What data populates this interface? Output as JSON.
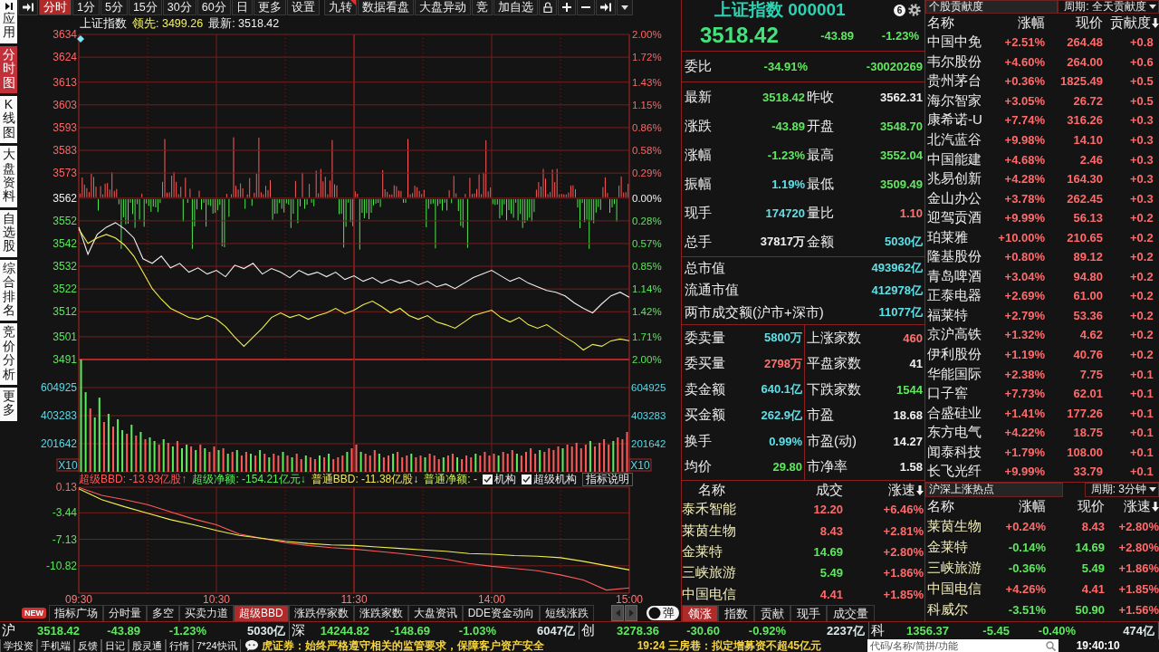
{
  "sidebar": {
    "tabs": [
      {
        "label": "应用",
        "selected": false
      },
      {
        "label": "分时图",
        "selected": true
      },
      {
        "label": "K线图",
        "selected": false
      },
      {
        "label": "大盘资料",
        "selected": false
      },
      {
        "label": "自选股",
        "selected": false
      },
      {
        "label": "综合排名",
        "selected": false
      },
      {
        "label": "竞价分析",
        "selected": false
      },
      {
        "label": "更多",
        "selected": false
      }
    ]
  },
  "toolbar": {
    "period_tabs": [
      {
        "label": "分时",
        "selected": true
      },
      {
        "label": "1分",
        "selected": false
      },
      {
        "label": "5分",
        "selected": false
      },
      {
        "label": "15分",
        "selected": false
      },
      {
        "label": "30分",
        "selected": false
      },
      {
        "label": "60分",
        "selected": false
      },
      {
        "label": "日",
        "selected": false
      },
      {
        "label": "更多",
        "selected": false
      },
      {
        "label": "设置",
        "selected": false
      }
    ],
    "actions": [
      {
        "label": "九转",
        "marked": true
      },
      {
        "label": "数据看盘",
        "marked": false
      },
      {
        "label": "大盘异动",
        "marked": false
      },
      {
        "label": "竞",
        "marked": false
      },
      {
        "label": "加自选",
        "marked": false
      }
    ]
  },
  "quote_line": [
    {
      "text": "上证指数",
      "color": "#f0f0f0"
    },
    {
      "text": "领先: 3499.26",
      "color": "#f0f060"
    },
    {
      "text": "最新: 3518.42",
      "color": "#f0f0f0"
    }
  ],
  "price_chart": {
    "chart_data": {
      "type": "line",
      "grid": true,
      "ylim": [
        3491,
        3634
      ],
      "yticks": [
        3634,
        3624,
        3613,
        3603,
        3593,
        3583,
        3573,
        3562,
        3552,
        3542,
        3532,
        3522,
        3512,
        3501,
        3491
      ],
      "series": [
        {
          "color": "#f0f0f0",
          "values": [
            3549.2,
            3537.3,
            3546.0,
            3549.2,
            3551.2,
            3548.4,
            3544.5,
            3535.3,
            3533.3,
            3536.5,
            3531.3,
            3533.3,
            3529.4,
            3531.3,
            3528.6,
            3530.2,
            3527.4,
            3532.5,
            3531.0,
            3533.3,
            3528.6,
            3531.0,
            3529.4,
            3527.0,
            3530.2,
            3528.2,
            3529.4,
            3527.4,
            3529.4,
            3526.2,
            3527.8,
            3525.4,
            3527.0,
            3524.6,
            3526.2,
            3524.6,
            3525.8,
            3523.8,
            3525.4,
            3523.0,
            3524.2,
            3522.2,
            3524.6,
            3527.0,
            3528.6,
            3530.2,
            3527.8,
            3525.4,
            3527.0,
            3524.6,
            3523.0,
            3521.4,
            3520.6,
            3519.0,
            3515.9,
            3513.5,
            3511.5,
            3515.5,
            3519.0,
            3520.6,
            3518.4
          ]
        },
        {
          "color": "#f0f050",
          "values": [
            3548.4,
            3542.1,
            3544.5,
            3546.0,
            3544.5,
            3541.3,
            3536.5,
            3529.4,
            3522.2,
            3517.5,
            3513.5,
            3511.5,
            3509.5,
            3508.7,
            3510.3,
            3508.7,
            3505.5,
            3500.8,
            3496.8,
            3500.8,
            3504.8,
            3509.5,
            3511.5,
            3509.5,
            3510.7,
            3508.7,
            3510.3,
            3511.5,
            3513.5,
            3511.1,
            3512.7,
            3515.1,
            3516.7,
            3514.3,
            3511.5,
            3513.5,
            3510.3,
            3508.7,
            3510.3,
            3507.5,
            3506.3,
            3504.8,
            3507.5,
            3510.3,
            3511.5,
            3512.7,
            3509.5,
            3507.5,
            3509.5,
            3506.3,
            3504.8,
            3506.3,
            3503.6,
            3500.8,
            3498.4,
            3495.2,
            3497.6,
            3496.8,
            3499.2,
            3500.0,
            3499.3
          ]
        }
      ]
    },
    "percent_labels": [
      "2.00%",
      "1.72%",
      "1.43%",
      "1.15%",
      "0.86%",
      "0.58%",
      "0.29%",
      "0.00%",
      "0.28%",
      "0.57%",
      "0.85%",
      "1.14%",
      "1.42%",
      "1.71%",
      "2.00%"
    ]
  },
  "volume_chart": {
    "chart_data": {
      "type": "bar",
      "grid": true,
      "ylim": [
        0,
        806566
      ],
      "yticks": [
        604925,
        403283,
        201642
      ],
      "series": [
        {
          "color": "#ff5a5a",
          "values": [
            0,
            0,
            455000,
            0,
            0,
            358000,
            0,
            325000,
            0,
            0,
            273000,
            0,
            260000,
            0,
            234000,
            0,
            0,
            195000,
            0,
            208000,
            0,
            221000,
            0,
            0,
            182000,
            0,
            195000,
            0,
            143000,
            182000,
            0,
            169000,
            0,
            143000,
            0,
            117000,
            143000,
            0,
            117000,
            0,
            130000,
            0,
            130000,
            117000,
            0,
            117000,
            0,
            130000,
            91000,
            0,
            104000,
            91000,
            0,
            104000,
            0,
            91000,
            104000,
            117000,
            0,
            169000,
            195000,
            0,
            130000,
            117000,
            156000,
            0,
            104000,
            117000,
            0,
            143000,
            104000,
            117000,
            0,
            104000,
            117000,
            0,
            130000,
            117000,
            91000,
            0,
            117000,
            130000,
            0,
            91000,
            117000,
            104000,
            0,
            117000,
            143000,
            117000,
            130000,
            0,
            143000,
            130000,
            156000,
            0,
            117000,
            143000,
            169000,
            130000,
            0,
            143000,
            169000,
            156000,
            182000,
            0,
            195000,
            182000,
            208000,
            169000,
            195000,
            0,
            182000,
            208000,
            234000,
            195000,
            0,
            247000,
            234000,
            286000
          ]
        },
        {
          "color": "#5aef5a",
          "values": [
            806000,
            572000,
            0,
            390000,
            533000,
            0,
            416000,
            0,
            377000,
            299000,
            0,
            338000,
            0,
            286000,
            0,
            247000,
            221000,
            0,
            234000,
            0,
            182000,
            0,
            169000,
            195000,
            0,
            156000,
            0,
            169000,
            0,
            0,
            156000,
            0,
            130000,
            0,
            156000,
            0,
            0,
            130000,
            0,
            156000,
            0,
            104000,
            0,
            0,
            143000,
            0,
            104000,
            0,
            0,
            117000,
            0,
            0,
            117000,
            0,
            130000,
            0,
            0,
            0,
            143000,
            0,
            0,
            143000,
            0,
            0,
            0,
            130000,
            0,
            0,
            130000,
            0,
            0,
            0,
            130000,
            0,
            0,
            104000,
            0,
            0,
            0,
            104000,
            0,
            0,
            104000,
            0,
            0,
            0,
            130000,
            0,
            0,
            0,
            0,
            117000,
            0,
            0,
            0,
            130000,
            0,
            0,
            0,
            0,
            156000,
            0,
            0,
            0,
            0,
            169000,
            0,
            0,
            0,
            0,
            0,
            221000,
            0,
            0,
            0,
            0,
            221000,
            0,
            0,
            0
          ]
        }
      ]
    },
    "right_labels": [
      "604925",
      "403283",
      "201642"
    ],
    "unit_label_left": "X10",
    "unit_label_right": "X10"
  },
  "bbd_header": {
    "readouts": [
      {
        "text": "超级BBD: -13.93亿股↑",
        "color": "#ff5a5a"
      },
      {
        "text": "超级净额: -154.21亿元↓",
        "color": "#5aef5a"
      },
      {
        "text": "普通BBD: -11.38亿股↓",
        "color": "#f0e860"
      },
      {
        "text": "普通净额: -",
        "color": "#c8f060"
      }
    ],
    "options": [
      {
        "label": "机构",
        "checked": true
      },
      {
        "label": "超级机构",
        "checked": true
      }
    ],
    "help_button": "指标说明"
  },
  "bbd_chart": {
    "chart_data": {
      "type": "line",
      "grid": true,
      "categories": [
        "09:30",
        null,
        null,
        null,
        null,
        null,
        "10:30",
        null,
        null,
        null,
        null,
        null,
        "11:30",
        null,
        null,
        null,
        null,
        null,
        "14:00",
        null,
        null,
        null,
        null,
        null,
        "15:00"
      ],
      "ylim": [
        -14.63,
        0.13
      ],
      "yticks": [
        0.13,
        -3.44,
        -7.13,
        -10.82
      ],
      "series": [
        {
          "color": "#ff5a5a",
          "values": [
            0.1,
            -1.0,
            -1.6,
            -2.3,
            -3.3,
            -4.3,
            -5.1,
            -6.4,
            -7.0,
            -7.6,
            -8.0,
            -8.3,
            -8.5,
            -8.8,
            -9.1,
            -9.5,
            -9.9,
            -10.5,
            -10.9,
            -11.2,
            -11.5,
            -12.1,
            -12.8,
            -14.2,
            -13.9
          ]
        },
        {
          "color": "#f0f050",
          "values": [
            -0.1,
            -1.6,
            -2.6,
            -3.5,
            -4.4,
            -5.1,
            -5.9,
            -6.6,
            -7.0,
            -7.4,
            -7.7,
            -7.9,
            -8.0,
            -8.2,
            -8.4,
            -8.6,
            -8.8,
            -9.1,
            -9.2,
            -9.4,
            -9.5,
            -9.7,
            -10.2,
            -10.8,
            -11.4
          ]
        }
      ]
    }
  },
  "indicator_tabs": {
    "new_badge": "NEW",
    "tabs": [
      {
        "label": "指标广场",
        "selected": false
      },
      {
        "label": "分时量",
        "selected": false
      },
      {
        "label": "多空",
        "selected": false
      },
      {
        "label": "买卖力道",
        "selected": false
      },
      {
        "label": "超级BBD",
        "selected": true
      },
      {
        "label": "涨跌停家数",
        "selected": false
      },
      {
        "label": "涨跌家数",
        "selected": false
      },
      {
        "label": "大盘资讯",
        "selected": false
      },
      {
        "label": "DDE资金动向",
        "selected": false
      },
      {
        "label": "短线涨跌",
        "selected": false
      }
    ]
  },
  "popup_toggle": {
    "label": "弹",
    "on": false
  },
  "quote_panel": {
    "title": "上证指数 000001",
    "alert_count": "6",
    "price": {
      "text": "3518.42",
      "color": "#44e27a"
    },
    "change": {
      "text": "-43.89",
      "color": "#5ee85e"
    },
    "change_pct": {
      "text": "-1.23%",
      "color": "#5ee85e"
    },
    "order_ratio": {
      "label": "委比",
      "value": {
        "text": "-34.91%",
        "color": "#5ee85e"
      },
      "difference": {
        "text": "-30020269",
        "color": "#5ee85e"
      }
    },
    "stats": [
      {
        "label": "最新",
        "value": "3518.42",
        "color": "#5ee85e"
      },
      {
        "label": "昨收",
        "value": "3562.31",
        "color": "#f0f0f0"
      },
      {
        "label": "涨跌",
        "value": "-43.89",
        "color": "#5ee85e"
      },
      {
        "label": "开盘",
        "value": "3548.70",
        "color": "#5ee85e"
      },
      {
        "label": "涨幅",
        "value": "-1.23%",
        "color": "#5ee85e"
      },
      {
        "label": "最高",
        "value": "3552.04",
        "color": "#5ee85e"
      },
      {
        "label": "振幅",
        "value": "1.19%",
        "color": "#5ee0e8"
      },
      {
        "label": "最低",
        "value": "3509.49",
        "color": "#5ee85e"
      },
      {
        "label": "现手",
        "value": "174720",
        "color": "#5ee0e8"
      },
      {
        "label": "量比",
        "value": "1.10",
        "color": "#ff7070"
      },
      {
        "label": "总手",
        "value": "37817万",
        "color": "#f0f0f0"
      },
      {
        "label": "金额",
        "value": "5030亿",
        "color": "#5ee0e8"
      }
    ],
    "market_values": [
      {
        "label": "总市值",
        "value": "493962亿",
        "color": "#5ee0e8"
      },
      {
        "label": "流通市值",
        "value": "412978亿",
        "color": "#5ee0e8"
      },
      {
        "label": "两市成交额(沪市+深市)",
        "value": "11077亿",
        "color": "#5ee0e8"
      }
    ],
    "breadth": [
      {
        "label": "委卖量",
        "value": "5800万",
        "color": "#5ee0e8"
      },
      {
        "label": "上涨家数",
        "value": "460",
        "color": "#ff7070"
      },
      {
        "label": "委买量",
        "value": "2798万",
        "color": "#ff7070"
      },
      {
        "label": "平盘家数",
        "value": "41",
        "color": "#f0f0f0"
      },
      {
        "label": "卖金额",
        "value": "640.1亿",
        "color": "#5ee0e8"
      },
      {
        "label": "下跌家数",
        "value": "1544",
        "color": "#5ee85e"
      },
      {
        "label": "买金额",
        "value": "262.9亿",
        "color": "#5ee0e8"
      },
      {
        "label": "市盈",
        "value": "18.68",
        "color": "#f0f0f0"
      },
      {
        "label": "换手",
        "value": "0.99%",
        "color": "#5ee0e8"
      },
      {
        "label": "市盈(动)",
        "value": "14.27",
        "color": "#f0f0f0"
      },
      {
        "label": "均价",
        "value": "29.80",
        "color": "#5ee85e"
      },
      {
        "label": "市净率",
        "value": "1.58",
        "color": "#f0f0f0"
      }
    ]
  },
  "leaders": {
    "columns": [
      {
        "label": "名称",
        "sorted": false
      },
      {
        "label": "成交",
        "sorted": false
      },
      {
        "label": "涨速",
        "sorted": true
      }
    ],
    "rows": [
      {
        "cells": [
          {
            "text": "泰禾智能"
          },
          {
            "text": "12.20",
            "color": "#ff6a6a"
          },
          {
            "text": "+6.46%",
            "color": "#ff6a6a"
          }
        ]
      },
      {
        "cells": [
          {
            "text": "莱茵生物"
          },
          {
            "text": "8.43",
            "color": "#ff6a6a"
          },
          {
            "text": "+2.81%",
            "color": "#ff6a6a"
          }
        ]
      },
      {
        "cells": [
          {
            "text": "金莱特"
          },
          {
            "text": "14.69",
            "color": "#5ee85e"
          },
          {
            "text": "+2.80%",
            "color": "#ff6a6a"
          }
        ]
      },
      {
        "cells": [
          {
            "text": "三峡旅游"
          },
          {
            "text": "5.49",
            "color": "#5ee85e"
          },
          {
            "text": "+1.86%",
            "color": "#ff6a6a"
          }
        ]
      },
      {
        "cells": [
          {
            "text": "中国电信"
          },
          {
            "text": "4.41",
            "color": "#ff6a6a"
          },
          {
            "text": "+1.85%",
            "color": "#ff6a6a"
          }
        ]
      }
    ],
    "tabs": [
      {
        "label": "领涨",
        "selected": true
      },
      {
        "label": "指数",
        "selected": false
      },
      {
        "label": "贡献",
        "selected": false
      },
      {
        "label": "现手",
        "selected": false
      },
      {
        "label": "成交量",
        "selected": false
      }
    ]
  },
  "contribution_list": {
    "title": "个股贡献度",
    "period": "周期: 全天贡献度",
    "columns": [
      {
        "label": "名称",
        "sorted": false
      },
      {
        "label": "涨幅",
        "sorted": false
      },
      {
        "label": "现价",
        "sorted": false
      },
      {
        "label": "贡献度",
        "sorted": true
      }
    ],
    "rows": [
      {
        "cells": [
          {
            "text": "中国中免"
          },
          {
            "text": "+2.51%",
            "color": "#ff6a6a"
          },
          {
            "text": "264.48",
            "color": "#ff6a6a"
          },
          {
            "text": "+0.8",
            "color": "#ff6a6a"
          }
        ]
      },
      {
        "cells": [
          {
            "text": "韦尔股份"
          },
          {
            "text": "+4.60%",
            "color": "#ff6a6a"
          },
          {
            "text": "264.00",
            "color": "#ff6a6a"
          },
          {
            "text": "+0.6",
            "color": "#ff6a6a"
          }
        ]
      },
      {
        "cells": [
          {
            "text": "贵州茅台"
          },
          {
            "text": "+0.36%",
            "color": "#ff6a6a"
          },
          {
            "text": "1825.49",
            "color": "#ff6a6a"
          },
          {
            "text": "+0.5",
            "color": "#ff6a6a"
          }
        ]
      },
      {
        "cells": [
          {
            "text": "海尔智家"
          },
          {
            "text": "+3.05%",
            "color": "#ff6a6a"
          },
          {
            "text": "26.72",
            "color": "#ff6a6a"
          },
          {
            "text": "+0.5",
            "color": "#ff6a6a"
          }
        ]
      },
      {
        "cells": [
          {
            "text": "康希诺-U"
          },
          {
            "text": "+7.74%",
            "color": "#ff6a6a"
          },
          {
            "text": "316.26",
            "color": "#ff6a6a"
          },
          {
            "text": "+0.3",
            "color": "#ff6a6a"
          }
        ]
      },
      {
        "cells": [
          {
            "text": "北汽蓝谷"
          },
          {
            "text": "+9.98%",
            "color": "#ff6a6a"
          },
          {
            "text": "14.10",
            "color": "#ff6a6a"
          },
          {
            "text": "+0.3",
            "color": "#ff6a6a"
          }
        ]
      },
      {
        "cells": [
          {
            "text": "中国能建"
          },
          {
            "text": "+4.68%",
            "color": "#ff6a6a"
          },
          {
            "text": "2.46",
            "color": "#ff6a6a"
          },
          {
            "text": "+0.3",
            "color": "#ff6a6a"
          }
        ]
      },
      {
        "cells": [
          {
            "text": "兆易创新"
          },
          {
            "text": "+4.28%",
            "color": "#ff6a6a"
          },
          {
            "text": "164.30",
            "color": "#ff6a6a"
          },
          {
            "text": "+0.3",
            "color": "#ff6a6a"
          }
        ]
      },
      {
        "cells": [
          {
            "text": "金山办公"
          },
          {
            "text": "+3.78%",
            "color": "#ff6a6a"
          },
          {
            "text": "262.45",
            "color": "#ff6a6a"
          },
          {
            "text": "+0.3",
            "color": "#ff6a6a"
          }
        ]
      },
      {
        "cells": [
          {
            "text": "迎驾贡酒"
          },
          {
            "text": "+9.99%",
            "color": "#ff6a6a"
          },
          {
            "text": "56.13",
            "color": "#ff6a6a"
          },
          {
            "text": "+0.2",
            "color": "#ff6a6a"
          }
        ]
      },
      {
        "cells": [
          {
            "text": "珀莱雅"
          },
          {
            "text": "+10.00%",
            "color": "#ff6a6a"
          },
          {
            "text": "210.65",
            "color": "#ff6a6a"
          },
          {
            "text": "+0.2",
            "color": "#ff6a6a"
          }
        ]
      },
      {
        "cells": [
          {
            "text": "隆基股份"
          },
          {
            "text": "+0.80%",
            "color": "#ff6a6a"
          },
          {
            "text": "89.12",
            "color": "#ff6a6a"
          },
          {
            "text": "+0.2",
            "color": "#ff6a6a"
          }
        ]
      },
      {
        "cells": [
          {
            "text": "青岛啤酒"
          },
          {
            "text": "+3.04%",
            "color": "#ff6a6a"
          },
          {
            "text": "94.80",
            "color": "#ff6a6a"
          },
          {
            "text": "+0.2",
            "color": "#ff6a6a"
          }
        ]
      },
      {
        "cells": [
          {
            "text": "正泰电器"
          },
          {
            "text": "+2.69%",
            "color": "#ff6a6a"
          },
          {
            "text": "61.00",
            "color": "#ff6a6a"
          },
          {
            "text": "+0.2",
            "color": "#ff6a6a"
          }
        ]
      },
      {
        "cells": [
          {
            "text": "福莱特"
          },
          {
            "text": "+2.79%",
            "color": "#ff6a6a"
          },
          {
            "text": "53.36",
            "color": "#ff6a6a"
          },
          {
            "text": "+0.2",
            "color": "#ff6a6a"
          }
        ]
      },
      {
        "cells": [
          {
            "text": "京沪高铁"
          },
          {
            "text": "+1.32%",
            "color": "#ff6a6a"
          },
          {
            "text": "4.62",
            "color": "#ff6a6a"
          },
          {
            "text": "+0.2",
            "color": "#ff6a6a"
          }
        ]
      },
      {
        "cells": [
          {
            "text": "伊利股份"
          },
          {
            "text": "+1.19%",
            "color": "#ff6a6a"
          },
          {
            "text": "40.76",
            "color": "#ff6a6a"
          },
          {
            "text": "+0.2",
            "color": "#ff6a6a"
          }
        ]
      },
      {
        "cells": [
          {
            "text": "华能国际"
          },
          {
            "text": "+2.38%",
            "color": "#ff6a6a"
          },
          {
            "text": "7.75",
            "color": "#ff6a6a"
          },
          {
            "text": "+0.1",
            "color": "#ff6a6a"
          }
        ]
      },
      {
        "cells": [
          {
            "text": "口子窖"
          },
          {
            "text": "+7.73%",
            "color": "#ff6a6a"
          },
          {
            "text": "62.01",
            "color": "#ff6a6a"
          },
          {
            "text": "+0.1",
            "color": "#ff6a6a"
          }
        ]
      },
      {
        "cells": [
          {
            "text": "合盛硅业"
          },
          {
            "text": "+1.41%",
            "color": "#ff6a6a"
          },
          {
            "text": "177.26",
            "color": "#ff6a6a"
          },
          {
            "text": "+0.1",
            "color": "#ff6a6a"
          }
        ]
      },
      {
        "cells": [
          {
            "text": "东方电气"
          },
          {
            "text": "+4.22%",
            "color": "#ff6a6a"
          },
          {
            "text": "18.75",
            "color": "#ff6a6a"
          },
          {
            "text": "+0.1",
            "color": "#ff6a6a"
          }
        ]
      },
      {
        "cells": [
          {
            "text": "闻泰科技"
          },
          {
            "text": "+1.79%",
            "color": "#ff6a6a"
          },
          {
            "text": "108.00",
            "color": "#ff6a6a"
          },
          {
            "text": "+0.1",
            "color": "#ff6a6a"
          }
        ]
      },
      {
        "cells": [
          {
            "text": "长飞光纤"
          },
          {
            "text": "+9.99%",
            "color": "#ff6a6a"
          },
          {
            "text": "33.79",
            "color": "#ff6a6a"
          },
          {
            "text": "+0.1",
            "color": "#ff6a6a"
          }
        ]
      }
    ]
  },
  "hot_list": {
    "title": "沪深上涨热点",
    "period": "周期: 3分钟",
    "columns": [
      {
        "label": "名称",
        "sorted": false
      },
      {
        "label": "涨幅",
        "sorted": false
      },
      {
        "label": "现价",
        "sorted": false
      },
      {
        "label": "涨速",
        "sorted": true
      }
    ],
    "rows": [
      {
        "cells": [
          {
            "text": "莱茵生物"
          },
          {
            "text": "+0.24%",
            "color": "#ff6a6a"
          },
          {
            "text": "8.43",
            "color": "#ff6a6a"
          },
          {
            "text": "+2.80%",
            "color": "#ff6a6a"
          }
        ]
      },
      {
        "cells": [
          {
            "text": "金莱特"
          },
          {
            "text": "-0.14%",
            "color": "#5ee85e"
          },
          {
            "text": "14.69",
            "color": "#5ee85e"
          },
          {
            "text": "+2.80%",
            "color": "#ff6a6a"
          }
        ]
      },
      {
        "cells": [
          {
            "text": "三峡旅游"
          },
          {
            "text": "-0.36%",
            "color": "#5ee85e"
          },
          {
            "text": "5.49",
            "color": "#5ee85e"
          },
          {
            "text": "+1.86%",
            "color": "#ff6a6a"
          }
        ]
      },
      {
        "cells": [
          {
            "text": "中国电信"
          },
          {
            "text": "+4.26%",
            "color": "#ff6a6a"
          },
          {
            "text": "4.41",
            "color": "#ff6a6a"
          },
          {
            "text": "+1.85%",
            "color": "#ff6a6a"
          }
        ]
      },
      {
        "cells": [
          {
            "text": "科威尔"
          },
          {
            "text": "-3.51%",
            "color": "#5ee85e"
          },
          {
            "text": "50.90",
            "color": "#5ee85e"
          },
          {
            "text": "+1.56%",
            "color": "#ff6a6a"
          }
        ]
      }
    ]
  },
  "status_bar": [
    {
      "market": "沪",
      "price": "3518.42",
      "change": "-43.89",
      "change_pct": "-1.23%",
      "amount": "5030亿",
      "color": "#5ee85e"
    },
    {
      "market": "深",
      "price": "14244.82",
      "change": "-148.69",
      "change_pct": "-1.03%",
      "amount": "6047亿",
      "color": "#5ee85e"
    },
    {
      "market": "创",
      "price": "3278.36",
      "change": "-30.60",
      "change_pct": "-0.92%",
      "amount": "2237亿",
      "color": "#5ee85e"
    },
    {
      "market": "科",
      "price": "1356.37",
      "change": "-5.45",
      "change_pct": "-0.40%",
      "amount": "474亿",
      "color": "#5ee85e"
    }
  ],
  "bottom_bar": {
    "links": [
      "学投资",
      "手机端",
      "反馈",
      "日记",
      "股灵通",
      "行情",
      "7*24快讯"
    ],
    "news": [
      "虎证券：始终严格遵守相关的监管要求，保障客户资产安全",
      "19:24 三房巷：拟定增募资不超45亿元"
    ],
    "search": {
      "placeholder": "代码/名称/简拼/功能"
    },
    "clock": "19:40:10"
  }
}
